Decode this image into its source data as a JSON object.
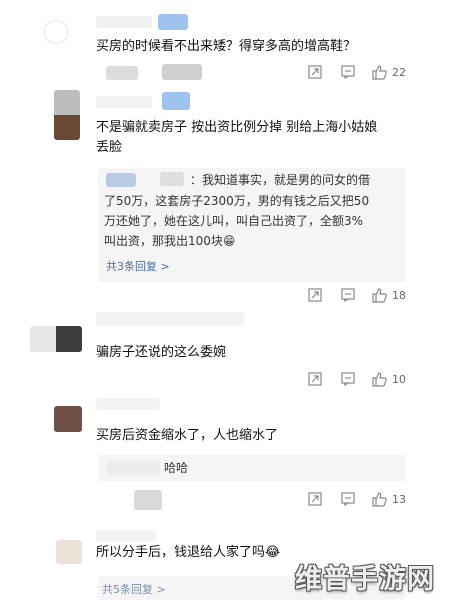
{
  "comments": [
    {
      "text": "买房的时候看不出来矮？得穿多高的增高鞋？",
      "likes": "22"
    },
    {
      "text_line1": "不是骗就卖房子 按出资比例分掉 别给上海小姑娘",
      "text_line2": "丢脸",
      "reply": {
        "line1": "：我知道事实，就是男的问女的借",
        "line2": "了50万，这套房子2300万，男的有钱之后又把50",
        "line3": "万还她了，她在这儿叫，叫自己出资了，全额3%",
        "line4": "叫出资，那我出100块😁"
      },
      "more_replies": "共3条回复 >",
      "likes": "18"
    },
    {
      "text": "骗房子还说的这么委婉",
      "likes": "10"
    },
    {
      "text": "买房后资金缩水了，人也缩水了",
      "reply": {
        "line1": "哈哈"
      },
      "likes": "13"
    },
    {
      "text": "所以分手后，钱退给人家了吗😂",
      "more_replies": "共5条回复 >"
    }
  ],
  "icons": {
    "share": "share-icon",
    "comment": "comment-icon",
    "like": "thumbs-up-icon"
  },
  "colors": {
    "link": "#4a6fa5",
    "reply_bg": "#f5f5f5",
    "count": "#666666"
  },
  "watermark": "维普手游网"
}
